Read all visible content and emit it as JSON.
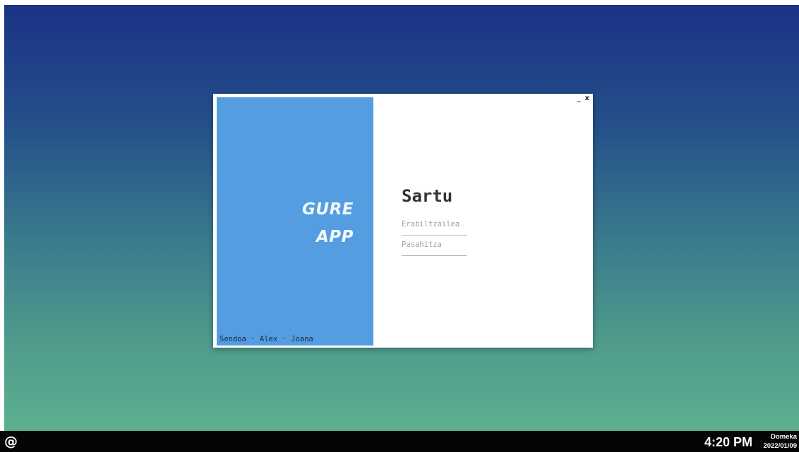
{
  "window": {
    "app_title_line1": "GURE",
    "app_title_line2": "APP",
    "authors": "Sendoa · Alex · Joana",
    "minimize_label": "_",
    "close_label": "x"
  },
  "login": {
    "title": "Sartu",
    "username_placeholder": "Erabiltzailea",
    "password_placeholder": "Pasahitza"
  },
  "taskbar": {
    "launcher_label": "@",
    "time": "4:20 PM",
    "weekday": "Domeka",
    "date": "2022/01/09"
  },
  "colors": {
    "panel_blue": "#539de0",
    "desktop_top": "#1b3286",
    "desktop_bottom": "#5cb08f",
    "taskbar": "#050505"
  }
}
